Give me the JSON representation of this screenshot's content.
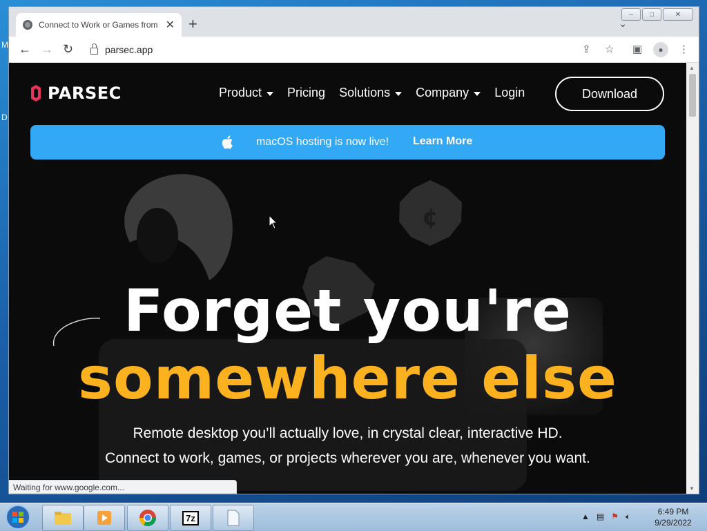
{
  "desktop": {
    "label_1": "M",
    "label_2": "D"
  },
  "browser": {
    "tab_title": "Connect to Work or Games from",
    "tab_close": "✕",
    "new_tab": "+",
    "tab_search_glyph": "⌄",
    "url": "parsec.app",
    "window_controls": {
      "minimize": "–",
      "maximize": "□",
      "close": "✕"
    }
  },
  "site": {
    "logo_text": "PARSEC",
    "nav": [
      {
        "label": "Product",
        "has_caret": true
      },
      {
        "label": "Pricing",
        "has_caret": false
      },
      {
        "label": "Solutions",
        "has_caret": true
      },
      {
        "label": "Company",
        "has_caret": true
      },
      {
        "label": "Login",
        "has_caret": false
      }
    ],
    "download_label": "Download",
    "banner": {
      "text": "macOS hosting is now live!",
      "link": "Learn More"
    },
    "hero": {
      "line1": "Forget you're",
      "line2": "somewhere else",
      "sub1": "Remote desktop you’ll actually love, in crystal clear, interactive HD.",
      "sub2": "Connect to work, games, or projects wherever you are, whenever you want."
    },
    "colors": {
      "accent_orange": "#fcb11e",
      "banner_blue": "#33a8f5",
      "logo_red": "#e8335a"
    }
  },
  "status_text": "Waiting for www.google.com...",
  "taskbar": {
    "items": [
      "file-explorer",
      "media-player",
      "chrome",
      "7zip",
      "document"
    ],
    "zip_label": "7z",
    "clock_time": "6:49 PM",
    "clock_date": "9/29/2022"
  }
}
